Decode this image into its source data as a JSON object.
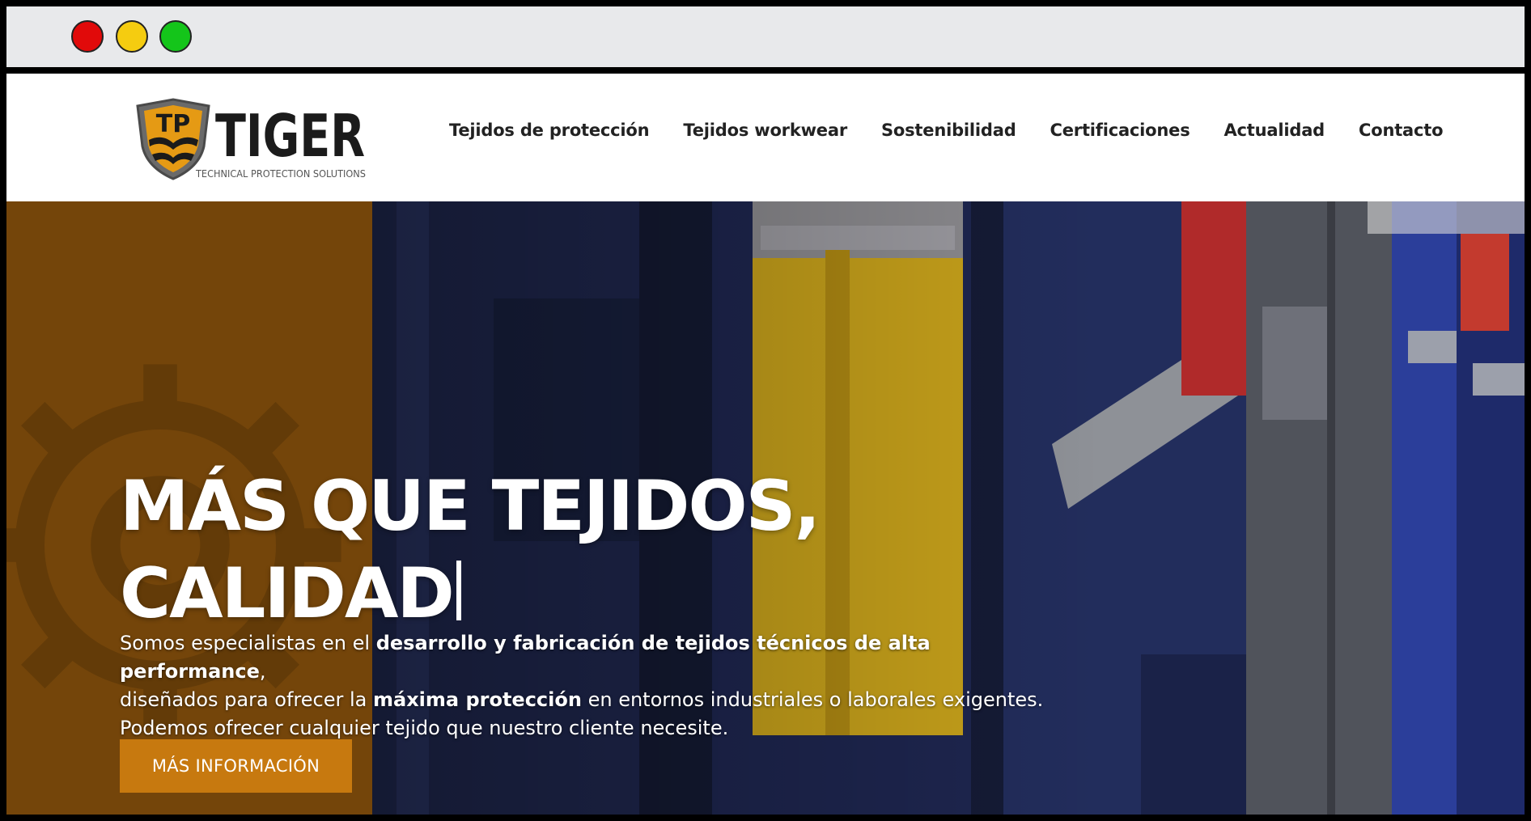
{
  "window": {
    "controls": [
      "close",
      "minimize",
      "maximize"
    ],
    "colors": {
      "close": "#e10a0a",
      "minimize": "#f5cc10",
      "maximize": "#14c51a"
    }
  },
  "brand": {
    "badge": "TP",
    "name": "TIGER",
    "tagline": "TECHNICAL PROTECTION SOLUTIONS"
  },
  "nav": {
    "items": [
      {
        "label": "Tejidos de protección"
      },
      {
        "label": "Tejidos workwear"
      },
      {
        "label": "Sostenibilidad"
      },
      {
        "label": "Certificaciones"
      },
      {
        "label": "Actualidad"
      },
      {
        "label": "Contacto"
      }
    ]
  },
  "hero": {
    "headline_line1": "MÁS QUE TEJIDOS,",
    "headline_line2": "CALIDAD",
    "desc_1": "Somos especialistas en el ",
    "desc_1_bold": "desarrollo y fabricación de tejidos técnicos de alta performance",
    "desc_1_end": ",",
    "desc_2": "diseñados para ofrecer la ",
    "desc_2_bold": "máxima protección",
    "desc_2_end": " en entornos industriales o laborales exigentes.",
    "desc_3": "Podemos ofrecer cualquier tejido que nuestro cliente necesite.",
    "cta_label": "MÁS INFORMACIÓN"
  },
  "colors": {
    "brand_brown": "#74450a",
    "cta_orange": "#c7790f",
    "nav_text": "#222222"
  }
}
